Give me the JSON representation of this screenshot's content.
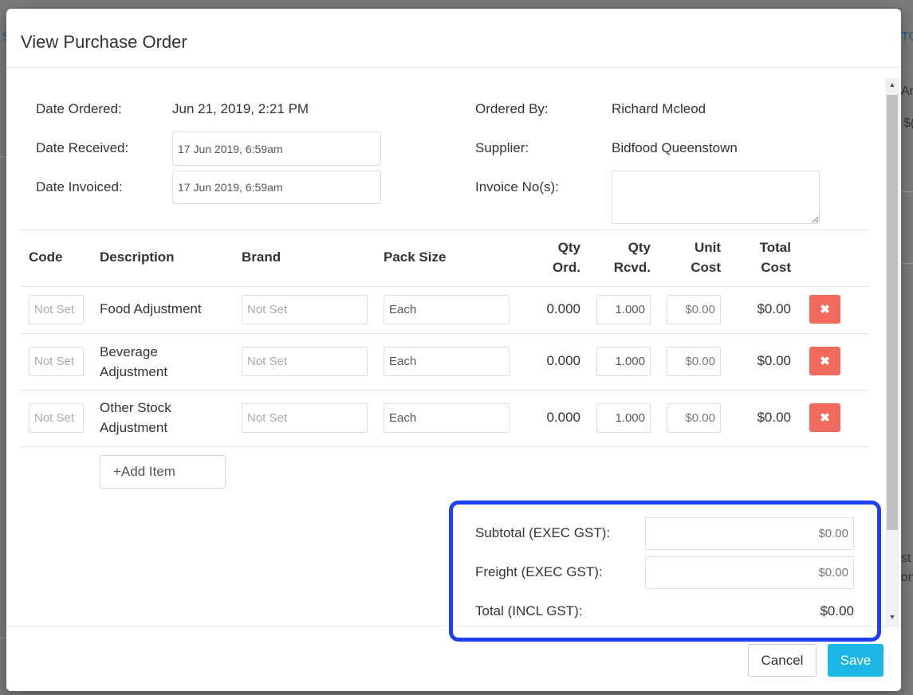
{
  "background": {
    "fragments": [
      "S",
      "TO",
      "An",
      "$(",
      "st",
      "on"
    ]
  },
  "modal": {
    "title": "View Purchase Order",
    "details": {
      "date_ordered_label": "Date Ordered:",
      "date_ordered_value": "Jun 21, 2019, 2:21 PM",
      "date_received_label": "Date Received:",
      "date_received_value": "17 Jun 2019, 6:59am",
      "date_invoiced_label": "Date Invoiced:",
      "date_invoiced_value": "17 Jun 2019, 6:59am",
      "ordered_by_label": "Ordered By:",
      "ordered_by_value": "Richard Mcleod",
      "supplier_label": "Supplier:",
      "supplier_value": "Bidfood Queenstown",
      "invoice_label": "Invoice No(s):",
      "invoice_value": ""
    },
    "table": {
      "headers": {
        "code": "Code",
        "description": "Description",
        "brand": "Brand",
        "pack_size": "Pack Size",
        "qty_ord_1": "Qty",
        "qty_ord_2": "Ord.",
        "qty_rcvd_1": "Qty",
        "qty_rcvd_2": "Rcvd.",
        "unit_cost_1": "Unit",
        "unit_cost_2": "Cost",
        "total_cost_1": "Total",
        "total_cost_2": "Cost"
      },
      "rows": [
        {
          "code": "Not Set",
          "desc1": "Food Adjustment",
          "desc2": "",
          "brand": "Not Set",
          "pack": "Each",
          "qty_ord": "0.000",
          "qty_rcvd": "1.000",
          "unit_cost": "$0.00",
          "total": "$0.00"
        },
        {
          "code": "Not Set",
          "desc1": "Beverage",
          "desc2": "Adjustment",
          "brand": "Not Set",
          "pack": "Each",
          "qty_ord": "0.000",
          "qty_rcvd": "1.000",
          "unit_cost": "$0.00",
          "total": "$0.00"
        },
        {
          "code": "Not Set",
          "desc1": "Other Stock",
          "desc2": "Adjustment",
          "brand": "Not Set",
          "pack": "Each",
          "qty_ord": "0.000",
          "qty_rcvd": "1.000",
          "unit_cost": "$0.00",
          "total": "$0.00"
        }
      ],
      "delete_glyph": "✖",
      "add_item_label": "+Add Item"
    },
    "totals": {
      "subtotal_label": "Subtotal (EXEC GST):",
      "subtotal_value": "$0.00",
      "freight_label": "Freight (EXEC GST):",
      "freight_value": "$0.00",
      "total_label": "Total (INCL GST):",
      "total_value": "$0.00"
    },
    "footer": {
      "cancel_label": "Cancel",
      "save_label": "Save"
    }
  },
  "colors": {
    "highlight_border": "#1f3ff5",
    "delete_button": "#f26a5c",
    "save_button": "#1cb6e6"
  }
}
